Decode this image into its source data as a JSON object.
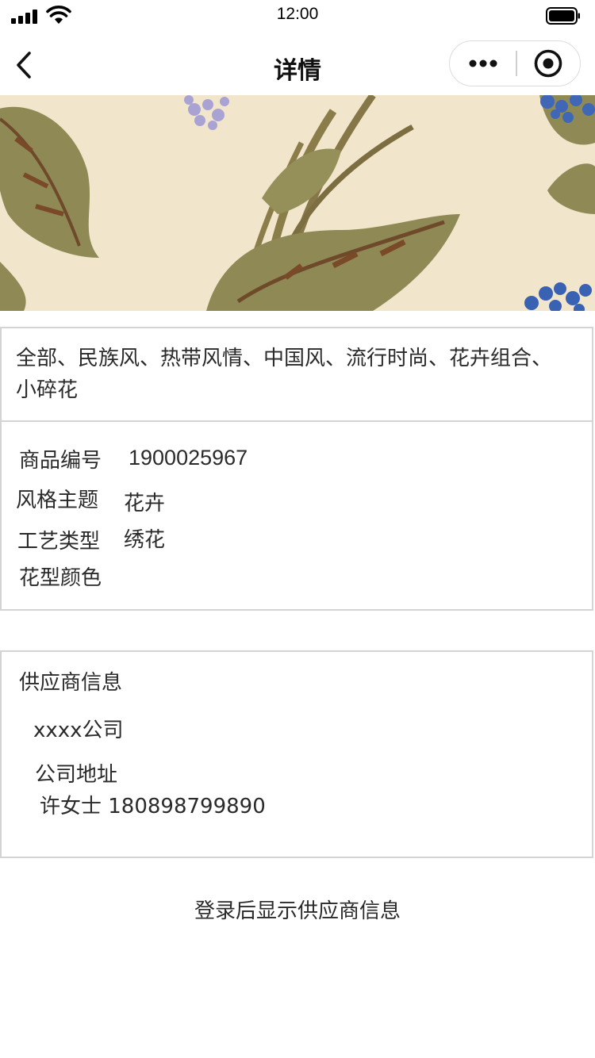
{
  "status_bar": {
    "time": "12:00"
  },
  "nav": {
    "title": "详情",
    "back_icon": "chevron-left-icon",
    "more_icon": "more-dots-icon",
    "close_icon": "target-close-icon"
  },
  "banner": {
    "description_icon": "floral-pattern-image"
  },
  "tags": {
    "text": "全部、民族风、热带风情、中国风、流行时尚、花卉组合、小碎花"
  },
  "specs": {
    "rows": [
      {
        "label": "商品编号",
        "value": "1900025967"
      },
      {
        "label": "风格主题",
        "value": "花卉"
      },
      {
        "label": "工艺类型",
        "value": "绣花"
      },
      {
        "label": "花型颜色",
        "value": ""
      }
    ]
  },
  "supplier": {
    "heading": "供应商信息",
    "company": "xxxx公司",
    "address_label": "公司地址",
    "contact": "许女士 180898799890"
  },
  "footer": {
    "login_hint": "登录后显示供应商信息"
  }
}
